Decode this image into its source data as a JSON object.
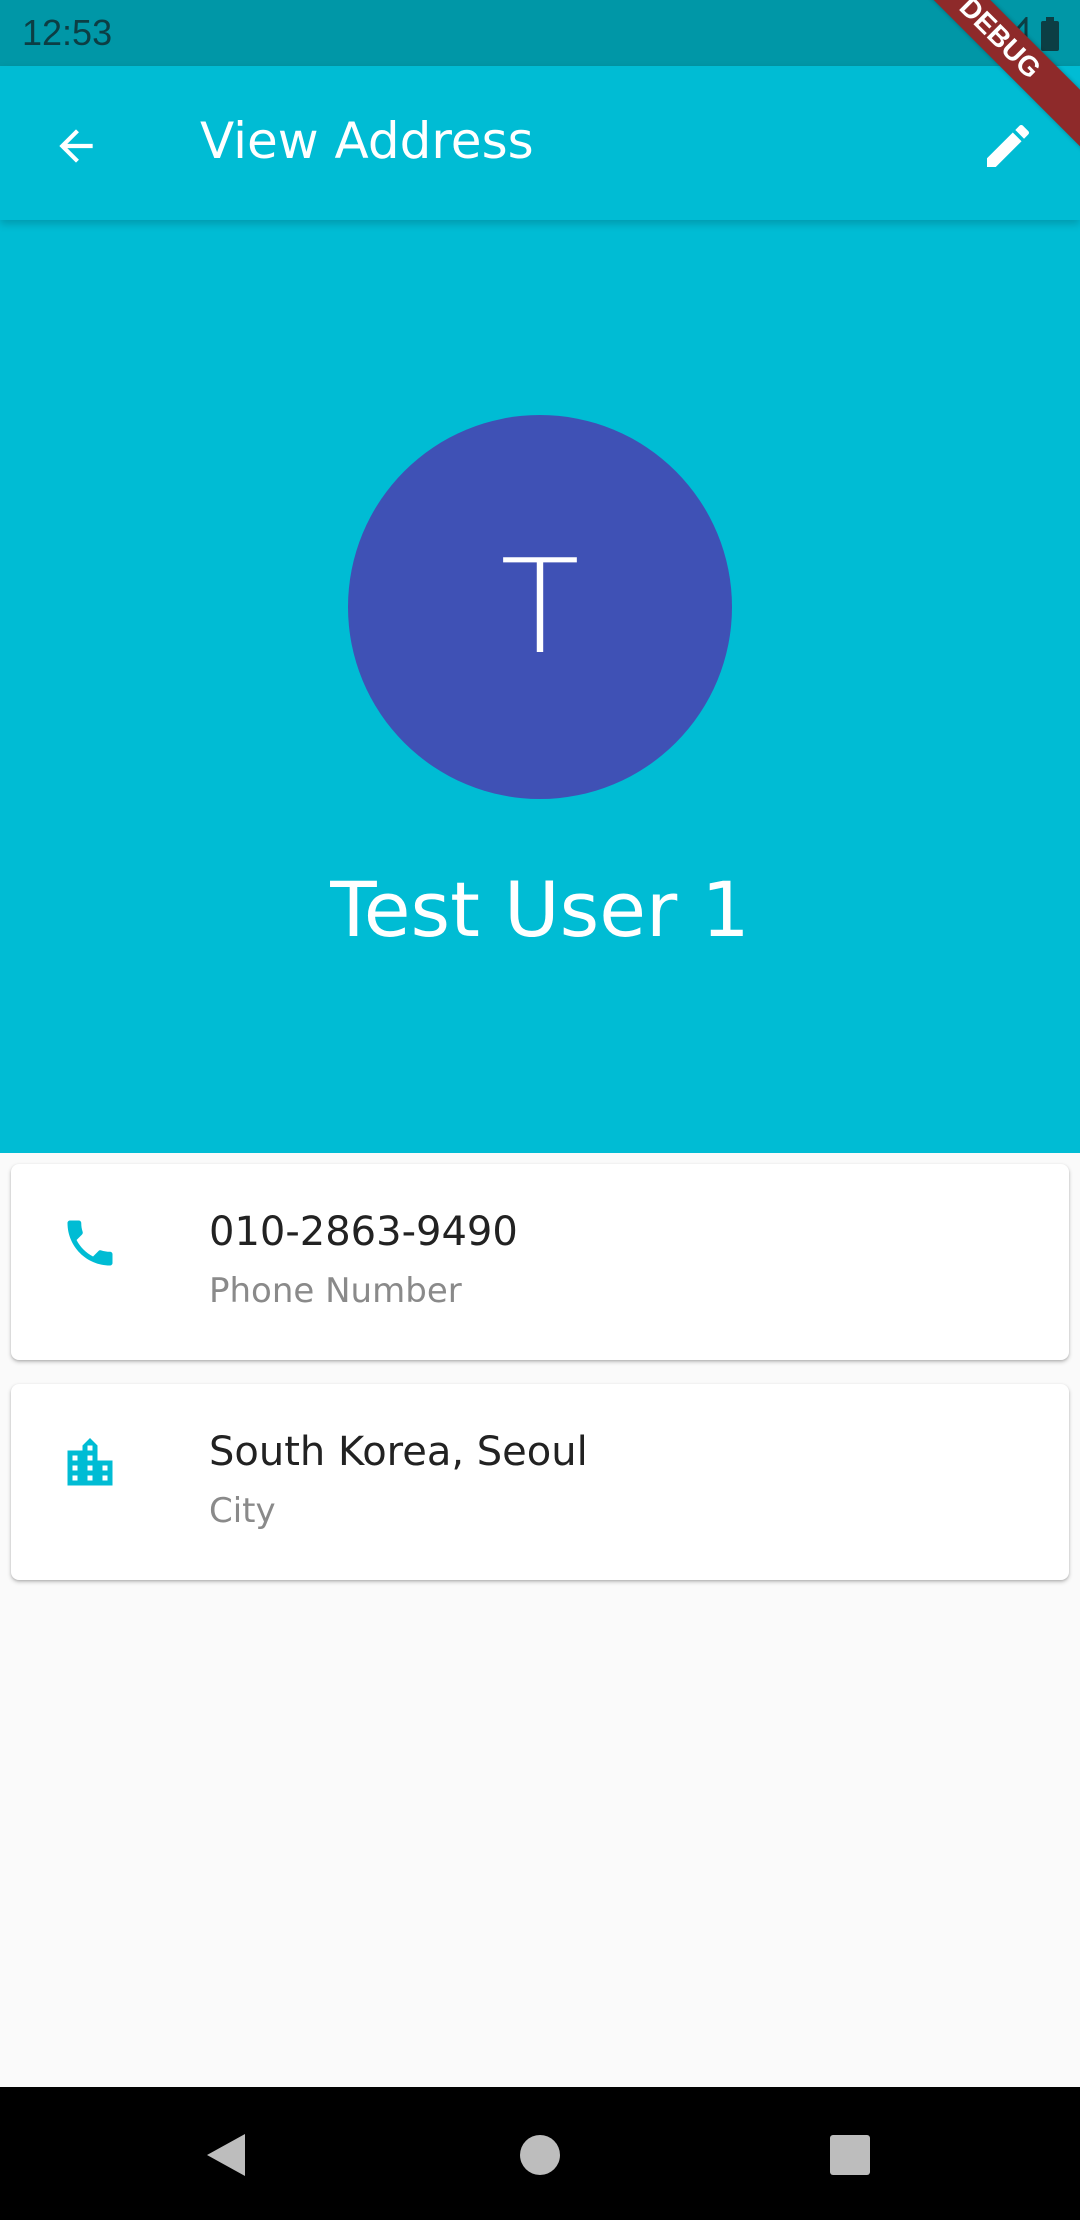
{
  "status_bar": {
    "time": "12:53"
  },
  "debug_banner": "DEBUG",
  "app_bar": {
    "title": "View Address",
    "back_icon": "arrow-back-icon",
    "edit_icon": "pencil-icon"
  },
  "contact": {
    "avatar_letter": "T",
    "name": "Test User 1"
  },
  "details": [
    {
      "icon": "phone-icon",
      "value": "010-2863-9490",
      "label": "Phone Number"
    },
    {
      "icon": "city-icon",
      "value": "South Korea, Seoul",
      "label": "City"
    }
  ],
  "colors": {
    "primary": "#00bcd4",
    "status_bar": "#0097a7",
    "avatar": "#3f51b5",
    "icon_accent": "#00bcd4",
    "background": "#fafafa"
  }
}
